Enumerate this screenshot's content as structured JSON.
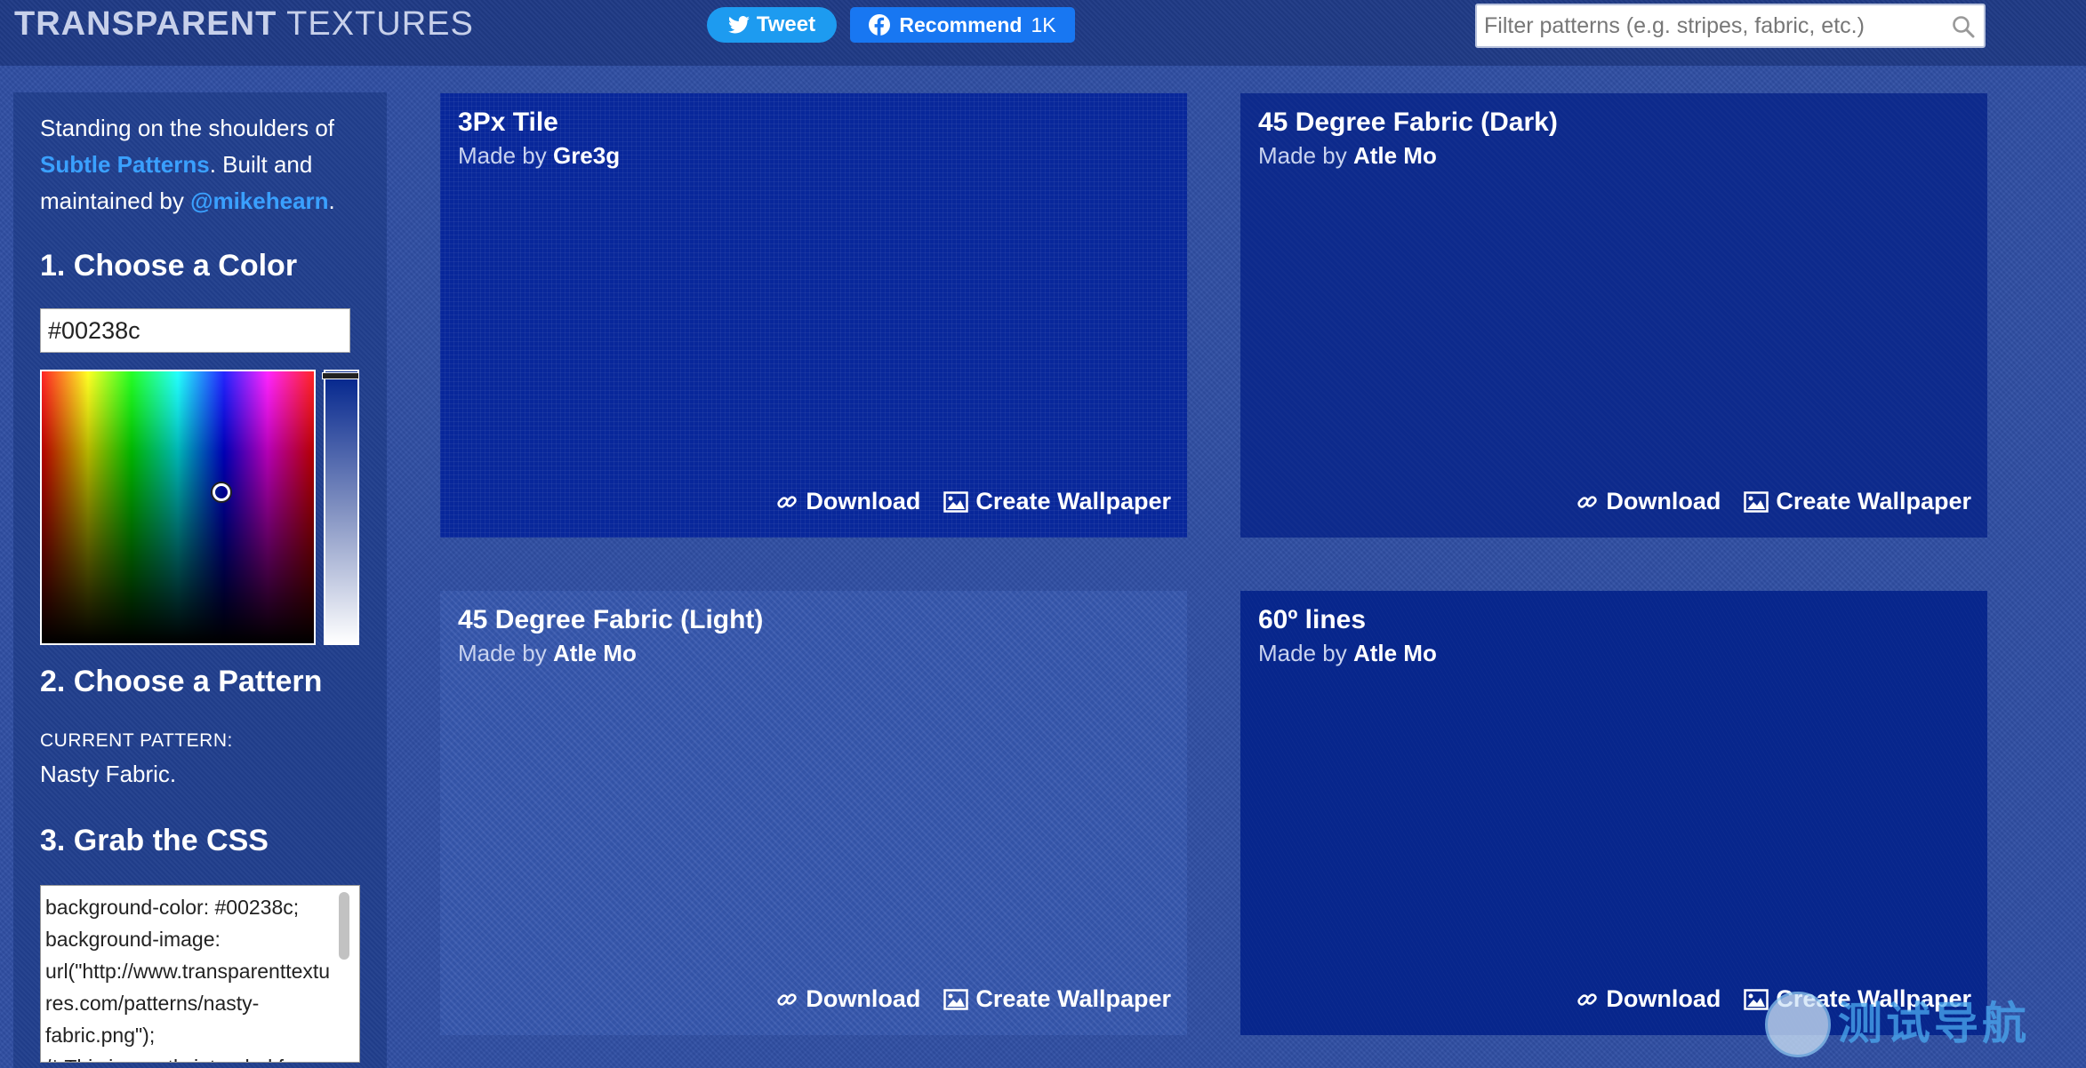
{
  "header": {
    "logo_bold": "TRANSPARENT",
    "logo_light": "TEXTURES",
    "tweet_label": "Tweet",
    "recommend_label": "Recommend",
    "recommend_count": "1K",
    "search_placeholder": "Filter patterns (e.g. stripes, fabric, etc.)"
  },
  "sidebar": {
    "intro_prefix": "Standing on the shoulders of ",
    "intro_link1": "Subtle Patterns",
    "intro_middle": ". Built and maintained by ",
    "intro_link2": "@mikehearn",
    "intro_suffix": ".",
    "step1_heading": "1. Choose a Color",
    "color_value": "#00238c",
    "step2_heading": "2. Choose a Pattern",
    "current_pattern_label": "CURRENT PATTERN:",
    "current_pattern_value": "Nasty Fabric.",
    "step3_heading": "3. Grab the CSS",
    "css_text": "background-color: #00238c;\nbackground-image: url(\"http://www.transparenttextures.com/patterns/nasty-fabric.png\");\n/* This is mostly intended for prototyping; please download the pattern and re-host for production environments. Thank you! */"
  },
  "cards": [
    {
      "title": "3Px Tile",
      "made_by": "Made by",
      "author": "Gre3g",
      "download": "Download",
      "wallpaper": "Create Wallpaper"
    },
    {
      "title": "45 Degree Fabric (Dark)",
      "made_by": "Made by",
      "author": "Atle Mo",
      "download": "Download",
      "wallpaper": "Create Wallpaper"
    },
    {
      "title": "45 Degree Fabric (Light)",
      "made_by": "Made by",
      "author": "Atle Mo",
      "download": "Download",
      "wallpaper": "Create Wallpaper"
    },
    {
      "title": "60º lines",
      "made_by": "Made by",
      "author": "Atle Mo",
      "download": "Download",
      "wallpaper": "Create Wallpaper"
    }
  ],
  "watermark": {
    "text": "测试导航"
  },
  "colors": {
    "accent_link": "#3aa0ff",
    "twitter": "#1d9bf0",
    "facebook": "#1877f2",
    "selected_color": "#00238c"
  }
}
